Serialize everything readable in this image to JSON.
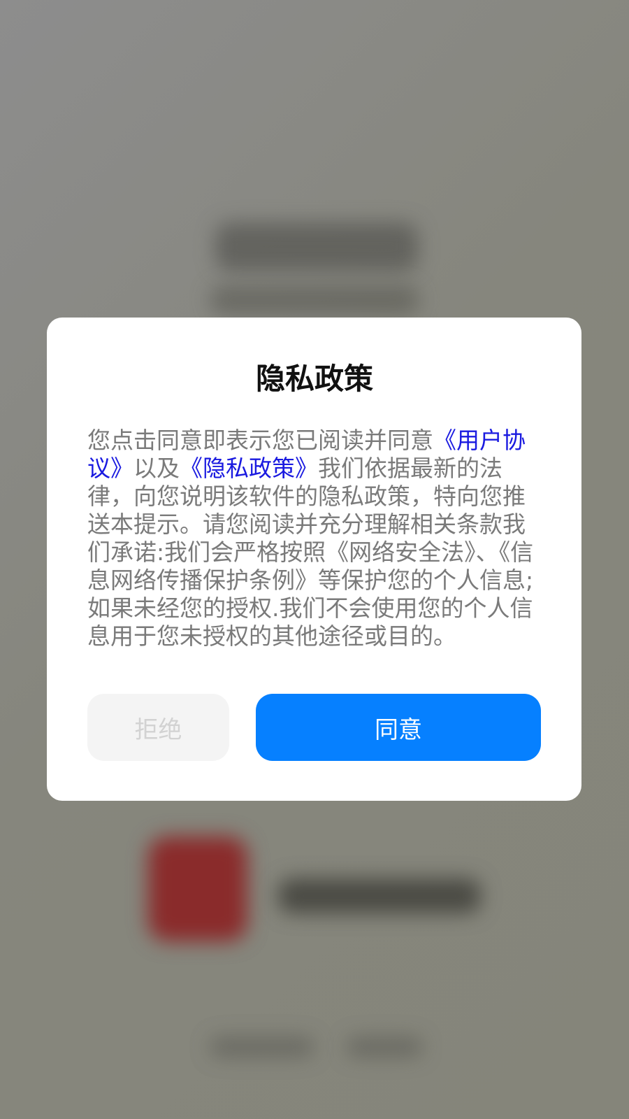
{
  "dialog": {
    "title": "隐私政策",
    "body": {
      "intro": "您点击同意即表示您已阅读并同意",
      "user_agreement_link": "《用户协议》",
      "and": "以及",
      "privacy_policy_link": "《隐私政策》",
      "rest": "我们依据最新的法律，向您说明该软件的隐私政策，特向您推送本提示。请您阅读并充分理解相关条款我们承诺:我们会严格按照《网络安全法》、《信息网络传播保护条例》等保护您的个人信息;如果未经您的授权.我们不会使用您的个人信息用于您未授权的其他途径或目的。"
    },
    "reject_label": "拒绝",
    "agree_label": "同意"
  },
  "colors": {
    "link": "#1a1ae0",
    "agree_button": "#0680ff",
    "reject_button_bg": "#f4f4f4",
    "reject_button_text": "#d2d2d2",
    "body_text": "#7a7a7a",
    "overlay": "#8a8a84"
  }
}
